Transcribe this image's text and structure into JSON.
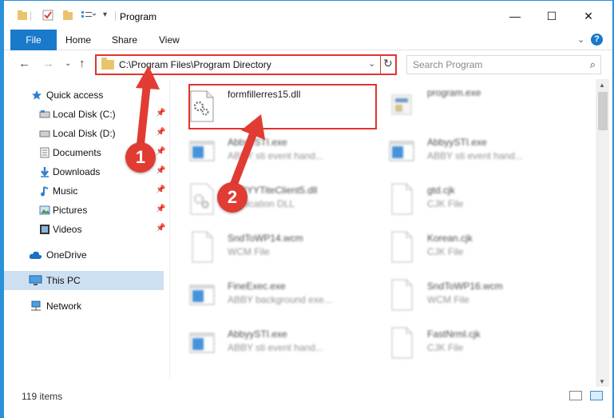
{
  "window": {
    "title": "Program",
    "controls": {
      "minimize": "—",
      "maximize": "☐",
      "close": "✕"
    }
  },
  "ribbon": {
    "tabs": [
      "File",
      "Home",
      "Share",
      "View"
    ],
    "help": "?"
  },
  "address": {
    "path": "C:\\Program Files\\Program Directory"
  },
  "search": {
    "placeholder": "Search Program"
  },
  "sidebar": {
    "items": [
      {
        "label": "Quick access",
        "icon": "star-icon",
        "pinned": false
      },
      {
        "label": "Local Disk (C:)",
        "icon": "drive-icon",
        "pinned": true
      },
      {
        "label": "Local Disk (D:)",
        "icon": "drive-icon",
        "pinned": true
      },
      {
        "label": "Documents",
        "icon": "documents-icon",
        "pinned": true
      },
      {
        "label": "Downloads",
        "icon": "download-icon",
        "pinned": true
      },
      {
        "label": "Music",
        "icon": "music-icon",
        "pinned": true
      },
      {
        "label": "Pictures",
        "icon": "pictures-icon",
        "pinned": true
      },
      {
        "label": "Videos",
        "icon": "videos-icon",
        "pinned": true
      },
      {
        "label": "OneDrive",
        "icon": "cloud-icon",
        "pinned": false
      },
      {
        "label": "This PC",
        "icon": "computer-icon",
        "pinned": false,
        "selected": true
      },
      {
        "label": "Network",
        "icon": "network-icon",
        "pinned": false
      }
    ]
  },
  "files": {
    "items": [
      {
        "name": "formfillerres15.dll",
        "type": "",
        "icon": "dll-gear-icon",
        "highlighted": true
      },
      {
        "name": "program.exe",
        "type": "",
        "icon": "exe-icon"
      },
      {
        "name": "AbbyySTI.exe",
        "type": "ABBY sti event hand...",
        "icon": "app-window-icon"
      },
      {
        "name": "AbbyySTI.exe",
        "type": "ABBY sti event hand...",
        "icon": "app-window-icon"
      },
      {
        "name": "ABBYYTiteClient5.dll",
        "type": "Application DLL",
        "icon": "dll-gear-icon"
      },
      {
        "name": "gtd.cjk",
        "type": "CJK File",
        "icon": "blank-file-icon"
      },
      {
        "name": "SndToWP14.wcm",
        "type": "WCM File",
        "icon": "blank-file-icon"
      },
      {
        "name": "Korean.cjk",
        "type": "CJK File",
        "icon": "blank-file-icon"
      },
      {
        "name": "FineExec.exe",
        "type": "ABBY background exe...",
        "icon": "app-window-icon"
      },
      {
        "name": "SndToWP16.wcm",
        "type": "WCM File",
        "icon": "blank-file-icon"
      },
      {
        "name": "AbbyySTI.exe",
        "type": "ABBY sti event hand...",
        "icon": "app-window-icon"
      },
      {
        "name": "FastNrml.cjk",
        "type": "CJK File",
        "icon": "blank-file-icon"
      }
    ]
  },
  "status": {
    "count": "119 items"
  },
  "annotations": {
    "step1": "1",
    "step2": "2",
    "accent": "#e13c33"
  }
}
